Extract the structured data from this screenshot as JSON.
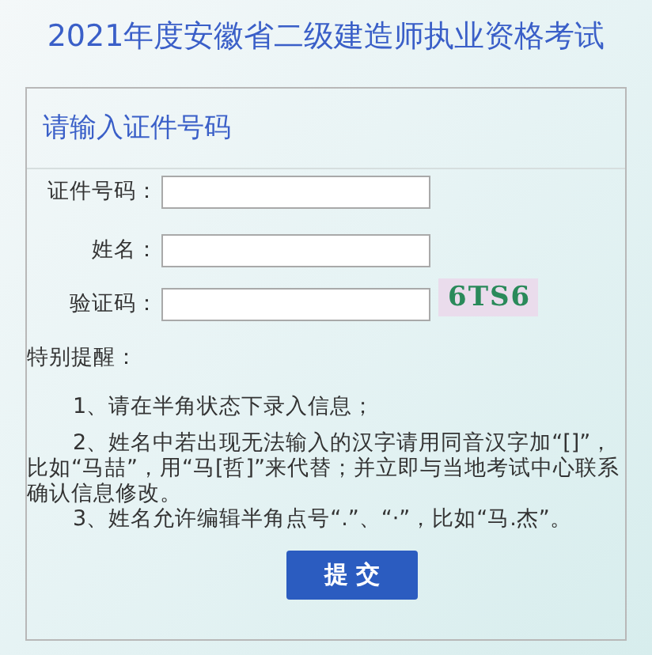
{
  "title": "2021年度安徽省二级建造师执业资格考试",
  "panel": {
    "heading": "请输入证件号码",
    "fields": [
      {
        "label": "证件号码：",
        "kind": "text"
      },
      {
        "label": "姓名：",
        "kind": "text"
      },
      {
        "label": "验证码：",
        "kind": "captcha",
        "captcha": "6TS6"
      }
    ],
    "notice_heading": "特别提醒：",
    "notes": [
      "1、请在半角状态下录入信息；",
      "2、姓名中若出现无法输入的汉字请用同音汉字加“[]”，比如“马喆”，用“马[哲]”来代替；并立即与当地考试中心联系确认信息修改。",
      "3、姓名允许编辑半角点号“.”、“·”，比如“马.杰”。"
    ],
    "submit_button": "提 交"
  }
}
